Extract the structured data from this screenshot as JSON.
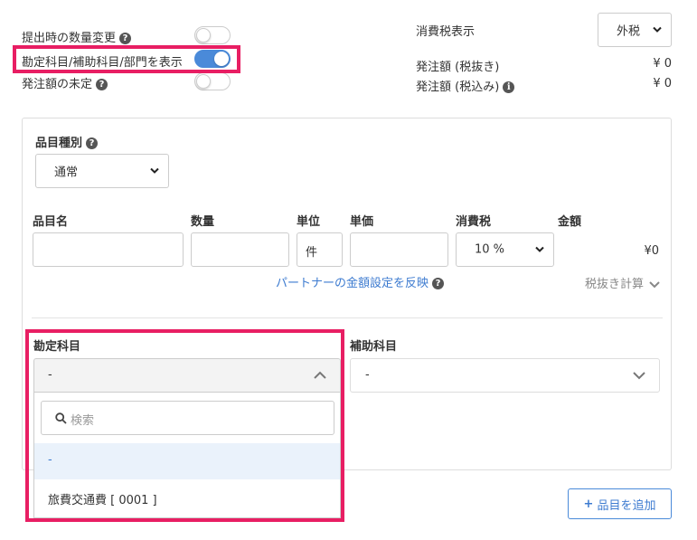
{
  "toggles": [
    {
      "label": "提出時の数量変更",
      "on": false
    },
    {
      "label": "勘定科目/補助科目/部門を表示",
      "on": true
    },
    {
      "label": "発注額の未定",
      "on": false
    }
  ],
  "tax": {
    "title": "消費税表示",
    "mode_value": "外税",
    "subtotal_label": "発注額 (税抜き)",
    "subtotal_value": "¥ 0",
    "total_label": "発注額 (税込み)",
    "total_value": "¥ 0"
  },
  "item": {
    "type_label": "品目種別",
    "type_value": "通常",
    "col_name": "品目名",
    "col_qty": "数量",
    "col_unit": "単位",
    "col_price": "単価",
    "col_tax": "消費税",
    "col_amount": "金額",
    "unit_value": "件",
    "tax_rate_value": "10 %",
    "amount_value": "¥0",
    "partner_link": "パートナーの金額設定を反映",
    "tax_calc": "税抜き計算"
  },
  "accounts": {
    "account_label": "勘定科目",
    "account_value": "-",
    "sub_label": "補助科目",
    "sub_value": "-",
    "search_placeholder": "検索",
    "options": [
      "-",
      "旅費交通費 [ 0001 ]"
    ]
  },
  "actions": {
    "add_item": "品目を追加"
  }
}
